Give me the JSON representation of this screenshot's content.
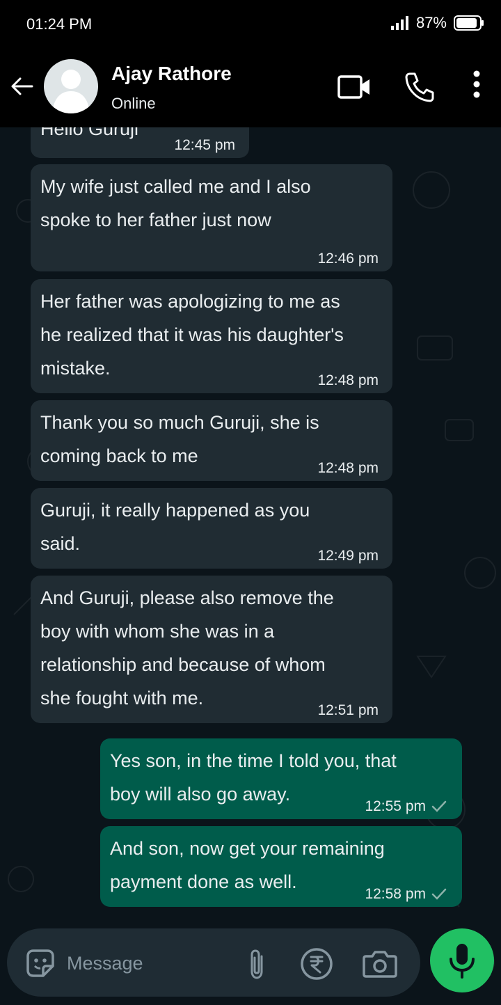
{
  "status_bar": {
    "time": "01:24 PM",
    "battery": "87%"
  },
  "header": {
    "contact_name": "Ajay Rathore",
    "contact_status": "Online"
  },
  "messages": [
    {
      "direction": "in",
      "text": "Hello Guruji",
      "time": "12:45 pm"
    },
    {
      "direction": "in",
      "text": "My wife just called me and I also\nspoke to her father just now",
      "time": "12:46 pm"
    },
    {
      "direction": "in",
      "text": "Her father was apologizing to me as\nhe realized that it was his daughter's\nmistake.",
      "time": "12:48 pm"
    },
    {
      "direction": "in",
      "text": "Thank you so much Guruji, she is\ncoming back to me",
      "time": "12:48 pm"
    },
    {
      "direction": "in",
      "text": "Guruji, it really happened as you\nsaid.",
      "time": "12:49 pm"
    },
    {
      "direction": "in",
      "text": "And Guruji, please also remove the\nboy with whom she was in a\nrelationship and because of whom\nshe fought with me.",
      "time": "12:51 pm"
    },
    {
      "direction": "out",
      "text": "Yes son, in the time I told you, that\nboy will also go away.",
      "time": "12:55 pm"
    },
    {
      "direction": "out",
      "text": "And son, now get your remaining\npayment done as well.",
      "time": "12:58 pm"
    }
  ],
  "composer": {
    "placeholder": "Message"
  },
  "colors": {
    "incoming_bubble": "#202c33",
    "outgoing_bubble": "#005c4b",
    "mic_button": "#21c063",
    "background": "#0b141a"
  }
}
